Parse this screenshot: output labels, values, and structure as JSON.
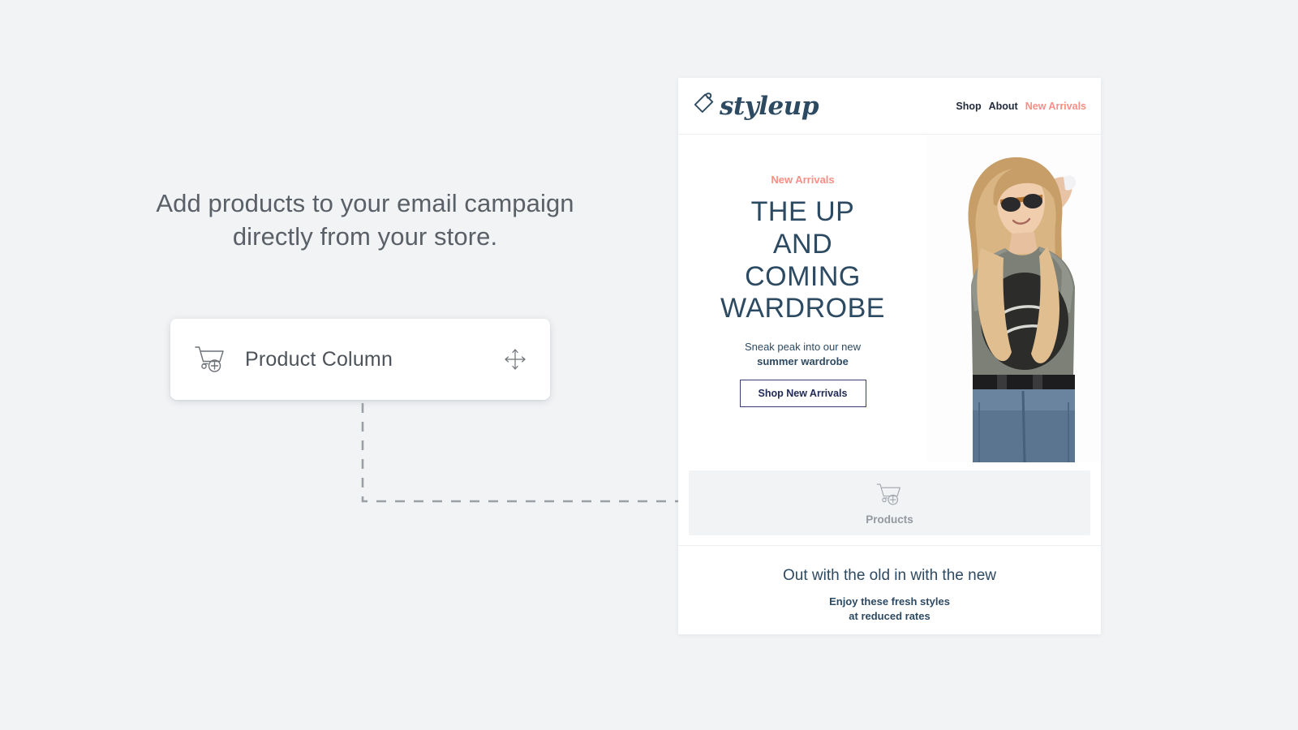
{
  "page": {
    "background_color": "#f1f3f5"
  },
  "promo": {
    "headline_line1": "Add products to your email campaign",
    "headline_line2": "directly from your store."
  },
  "drag_card": {
    "label": "Product Column",
    "cart_icon": "cart-plus-icon",
    "move_icon": "move-arrows-icon"
  },
  "email": {
    "header": {
      "logo_icon": "price-tag-icon",
      "brand": "styleup",
      "nav": [
        {
          "label": "Shop",
          "accent": false
        },
        {
          "label": "About",
          "accent": false
        },
        {
          "label": "New Arrivals",
          "accent": true
        }
      ]
    },
    "hero": {
      "eyebrow": "New Arrivals",
      "title_lines": [
        "THE UP",
        "AND",
        "COMING",
        "WARDROBE"
      ],
      "sub_regular": "Sneak peak into our new",
      "sub_bold": "summer wardrobe",
      "button_label": "Shop New Arrivals",
      "photo_alt": "model-wearing-graphic-tee"
    },
    "dropzone": {
      "label": "Products",
      "icon": "cart-plus-icon"
    },
    "footer": {
      "title": "Out with the old in with the new",
      "sub_line1": "Enjoy these fresh styles",
      "sub_line2": "at reduced rates"
    }
  },
  "colors": {
    "navy": "#2d4a63",
    "coral": "#fa8e85",
    "button_border": "#3b3c70",
    "muted_text": "#5a6067",
    "dropzone_bg": "#f1f3f5",
    "connector": "#9aa0a6"
  }
}
